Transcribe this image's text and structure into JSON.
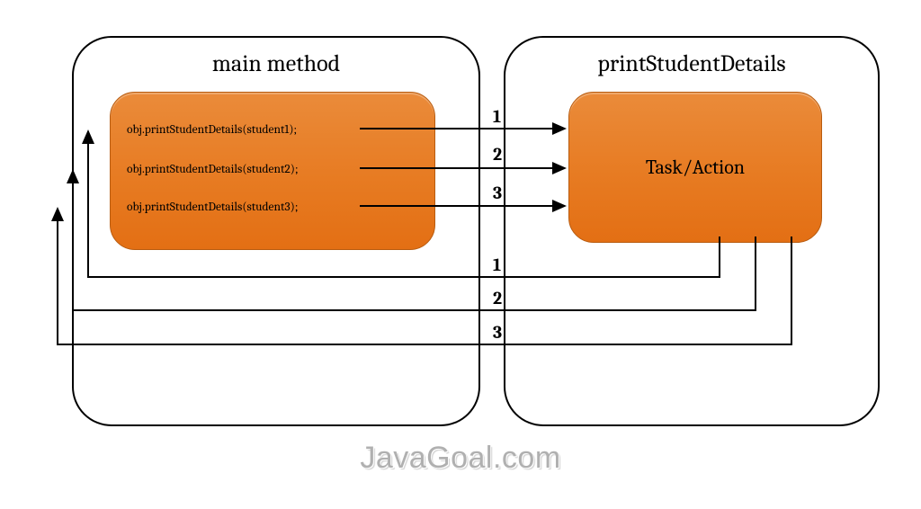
{
  "left": {
    "title": "main method",
    "lines": [
      "obj.printStudentDetails(student1);",
      "obj.printStudentDetails(student2);",
      "obj.printStudentDetails(student3);"
    ]
  },
  "right": {
    "title": "printStudentDetails",
    "content": "Task/Action"
  },
  "forward_labels": [
    "1",
    "2",
    "3"
  ],
  "return_labels": [
    "1",
    "2",
    "3"
  ],
  "watermark": "JavaGoal.com"
}
